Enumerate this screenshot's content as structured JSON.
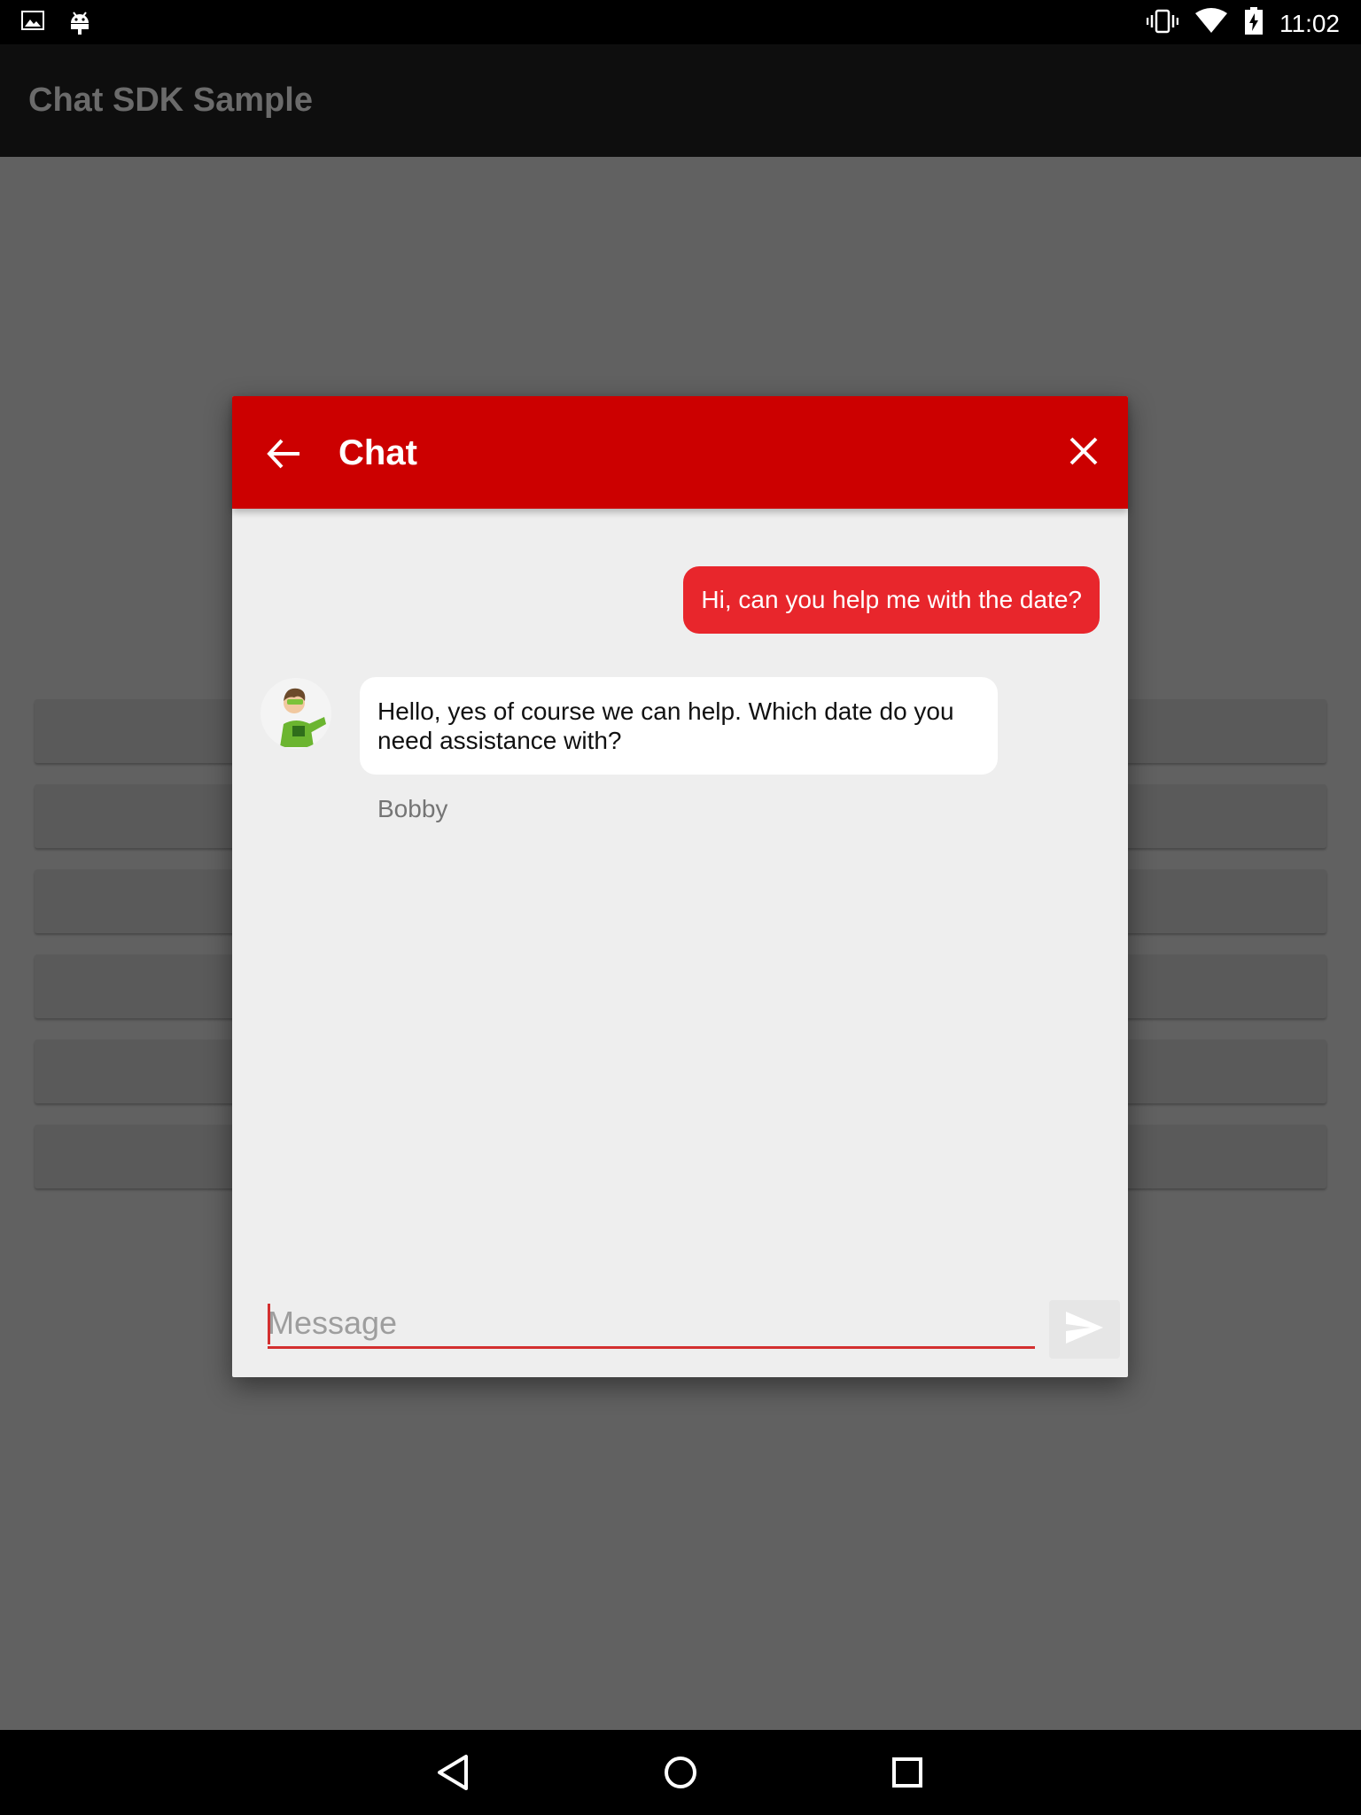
{
  "status_bar": {
    "time": "11:02",
    "left_icons": [
      "image-icon",
      "android-icon"
    ],
    "right_icons": [
      "vibrate-icon",
      "wifi-icon",
      "battery-charging-icon"
    ]
  },
  "app_bar": {
    "title": "Chat SDK Sample"
  },
  "background_list": {
    "row_count": 6
  },
  "chat_dialog": {
    "title": "Chat",
    "back_icon": "arrow-back-icon",
    "close_icon": "close-icon",
    "header_color": "#cc0000",
    "messages": [
      {
        "direction": "outgoing",
        "text": "Hi, can you help me with the date?",
        "color": "#e8262c"
      },
      {
        "direction": "incoming",
        "text": "Hello, yes of course we can help. Which date do you need assistance with?",
        "sender": "Bobby",
        "avatar_icon": "avatar-icon"
      }
    ],
    "input": {
      "placeholder": "Message",
      "value": ""
    },
    "send_icon": "send-icon"
  },
  "nav_bar": {
    "icons": [
      "back-triangle-icon",
      "home-circle-icon",
      "recents-square-icon"
    ]
  }
}
